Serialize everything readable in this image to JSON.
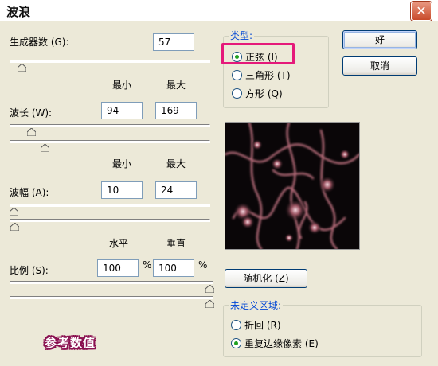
{
  "window": {
    "title": "波浪"
  },
  "generators": {
    "label": "生成器数 (G):",
    "value": "57",
    "slider_fraction": 0.05
  },
  "headers": {
    "min": "最小",
    "max": "最大",
    "horizontal": "水平",
    "vertical": "垂直"
  },
  "wavelength": {
    "label": "波长 (W):",
    "min": "94",
    "max": "169"
  },
  "amplitude": {
    "label": "波幅 (A):",
    "min": "10",
    "max": "24"
  },
  "scale": {
    "label": "比例 (S):",
    "horizontal": "100",
    "vertical": "100",
    "unit": "%"
  },
  "type_group": {
    "title": "类型:",
    "options": [
      {
        "label": "正弦 (I)",
        "selected": true
      },
      {
        "label": "三角形 (T)",
        "selected": false
      },
      {
        "label": "方形 (Q)",
        "selected": false
      }
    ]
  },
  "buttons": {
    "ok": "好",
    "cancel": "取消",
    "randomize": "随机化 (Z)"
  },
  "undefined_area": {
    "title": "未定义区域:",
    "options": [
      {
        "label": "折回 (R)",
        "selected": false
      },
      {
        "label": "重复边缘像素 (E)",
        "selected": true
      }
    ]
  },
  "annotation": {
    "text": "参考数值"
  },
  "colors": {
    "highlight": "#e5197a",
    "group_title": "#0046d5",
    "radio_dot": "#21a121"
  }
}
